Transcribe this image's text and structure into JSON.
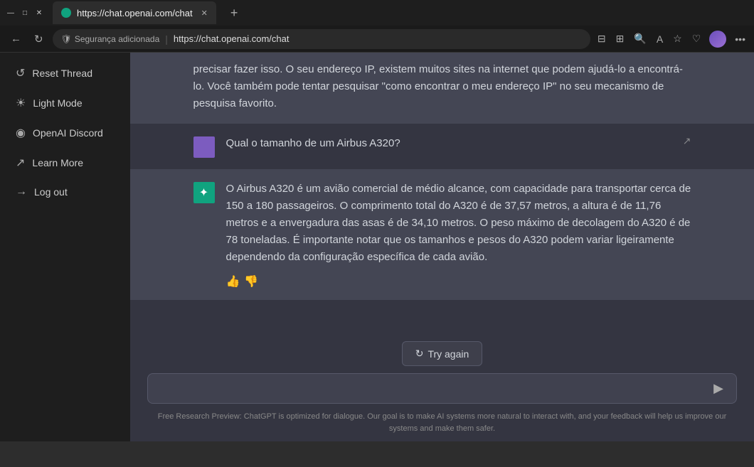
{
  "browser": {
    "tab_favicon": "●",
    "tab_title": "https://chat.openai.com/chat",
    "tab_close": "✕",
    "new_tab": "+",
    "nav_back": "←",
    "nav_refresh": "↻",
    "security_label": "Segurança adicionada",
    "address": "https://chat.openai.com/chat",
    "minimize": "—",
    "maximize": "□",
    "close": "✕",
    "toolbar_icons": [
      "⊞",
      "⊟",
      "🔍",
      "A",
      "☆",
      "♡",
      "•••"
    ]
  },
  "sidebar": {
    "items": [
      {
        "id": "reset-thread",
        "label": "Reset Thread",
        "icon": "↺"
      },
      {
        "id": "light-mode",
        "label": "Light Mode",
        "icon": "☀"
      },
      {
        "id": "discord",
        "label": "OpenAI Discord",
        "icon": "◉"
      },
      {
        "id": "learn-more",
        "label": "Learn More",
        "icon": "↗"
      },
      {
        "id": "log-out",
        "label": "Log out",
        "icon": "→"
      }
    ]
  },
  "chat": {
    "partial_text": "precisar fazer isso. O seu endereço IP, existem muitos sites na internet que podem ajudá-lo a encontrá-lo. Você também pode tentar pesquisar \"como encontrar o meu endereço IP\" no seu mecanismo de pesquisa favorito.",
    "user_question": "Qual o tamanho de um Airbus A320?",
    "assistant_response": "O Airbus A320 é um avião comercial de médio alcance, com capacidade para transportar cerca de 150 a 180 passageiros. O comprimento total do A320 é de 37,57 metros, a altura é de 11,76 metros e a envergadura das asas é de 34,10 metros. O peso máximo de decolagem do A320 é de 78 toneladas. É importante notar que os tamanhos e pesos do A320 podem variar ligeiramente dependendo da configuração específica de cada avião.",
    "try_again_label": "Try again",
    "input_placeholder": "",
    "footer_text": "Free Research Preview: ChatGPT is optimized for dialogue. Our goal is to make AI systems more natural to interact with, and your feedback will help us improve our systems and make them safer."
  }
}
